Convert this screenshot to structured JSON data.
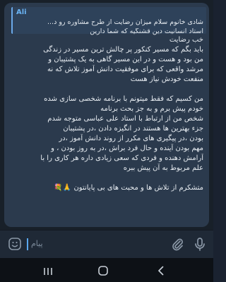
{
  "message": {
    "reply_author": "Ali",
    "reply_flag": "🌹",
    "reply_preview": "شادی خانوم سلام میزان رضایت از طرح مشاوره رو د...",
    "reply_tail": "استاد انسانیت دین قشنگیه که شما دارین",
    "lines": [
      "خب رضایت",
      "باید بگم که مسیر کنکور پر چالش ترین مسیر در زندگی",
      "من بود و هست و در این مسیر گاهی به یک پشتیبان و",
      "مرشد واقعی که برای موفقیت دانش آموز تلاش که نه",
      "منفعت خودش نیاز هست",
      "",
      "من کسیم که فقط میتونم با برنامه شخصی سازی شده",
      "خودم پیش برم و به جز بحث برنامه",
      "شخص من از ارتباط با استاد علی عباسی متوجه شدم",
      "جزء بهترین ها هستند در انگیزه دادن ،در پشتیبان",
      "بودن ،در پیگیری های مکرر از روند دانش آموز ،در",
      "مهم بودن آینده و حال فرد براش ،در به روز بودن ، و",
      "آرامش دهنده و فردی که سعی زیادی داره هر کاری را با",
      "علم مربوط به آن پیش ببره",
      "",
      "متشکرم از تلاش ها و محبت های بی پایانتون 🙏💐"
    ]
  },
  "composer": {
    "placeholder": "پیام",
    "icons": [
      "emoji-icon",
      "paperclip-icon",
      "microphone-icon"
    ]
  },
  "navbar": {
    "icons": [
      "recents-icon",
      "home-icon",
      "back-icon"
    ]
  },
  "colors": {
    "chat_background": "#182029",
    "bubble": "#2b3a4d",
    "accent": "#6ab3f3",
    "text": "#e8edf2"
  }
}
